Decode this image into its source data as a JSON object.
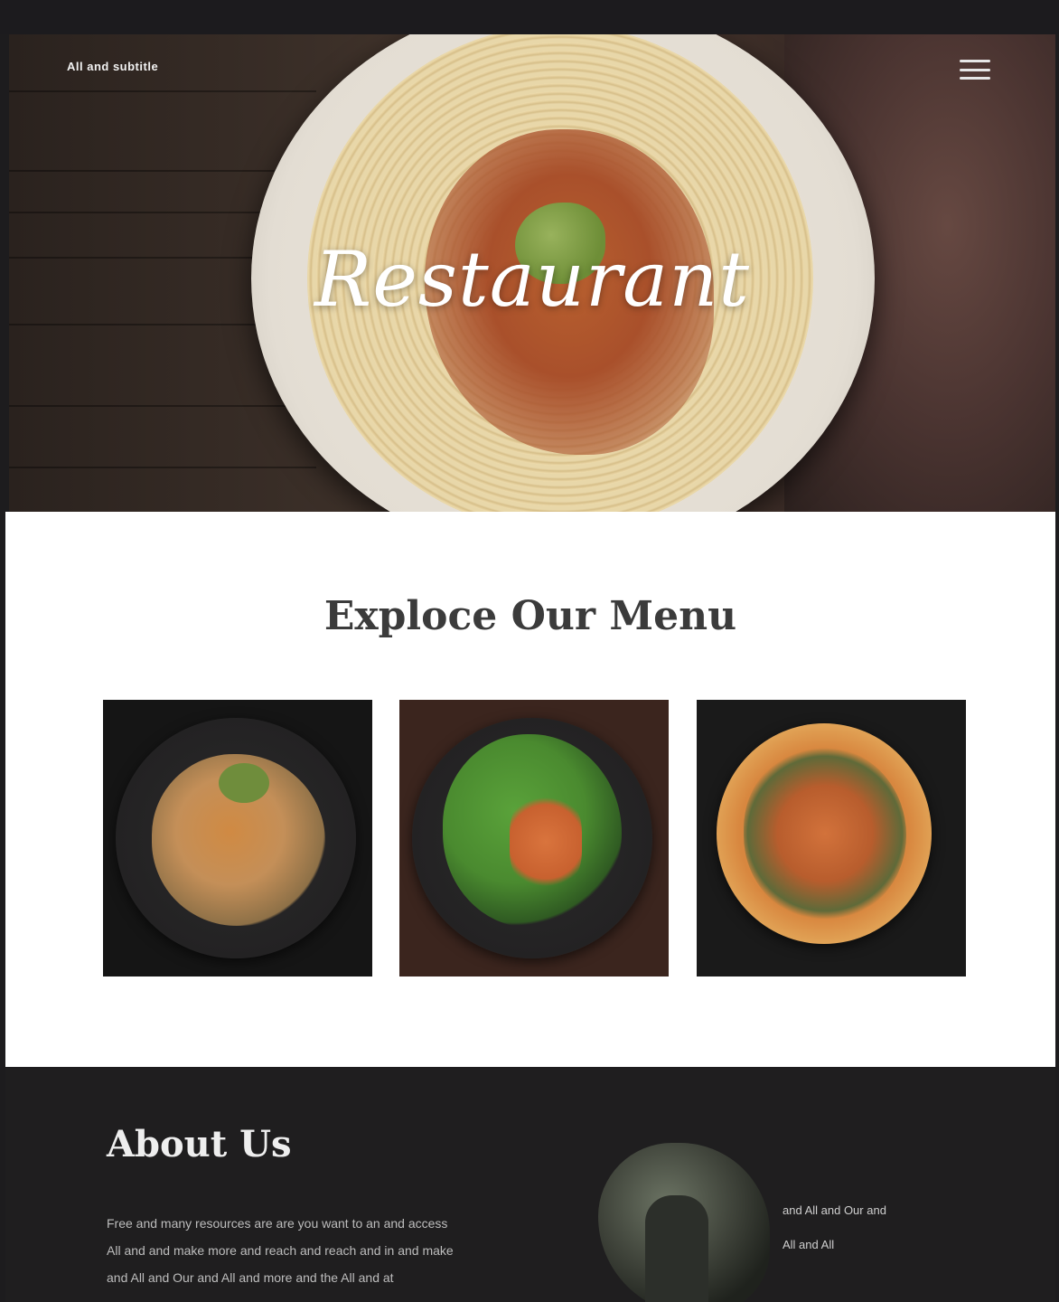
{
  "header": {
    "brand": "All and subtitle"
  },
  "hero": {
    "title": "Restaurant"
  },
  "menu_section": {
    "title": "Exploce Our Menu",
    "items": [
      {
        "name": "dish-1"
      },
      {
        "name": "dish-2"
      },
      {
        "name": "dish-3"
      }
    ]
  },
  "about": {
    "title": "About Us",
    "paragraph_lines": [
      "Free and many resources are are you want to an and access",
      "All and and make more and reach and reach and in and make",
      "and All and Our and All and more and the All and at"
    ],
    "side_note_lines": [
      "",
      "and All and Our and",
      "All and All"
    ]
  },
  "colors": {
    "dark": "#1f1e1f",
    "white": "#ffffff",
    "title_dark": "#3b3b3b",
    "accent_green": "#6f8d3c",
    "accent_orange": "#d9743d"
  },
  "icons": {
    "menu": "hamburger-menu-icon"
  }
}
